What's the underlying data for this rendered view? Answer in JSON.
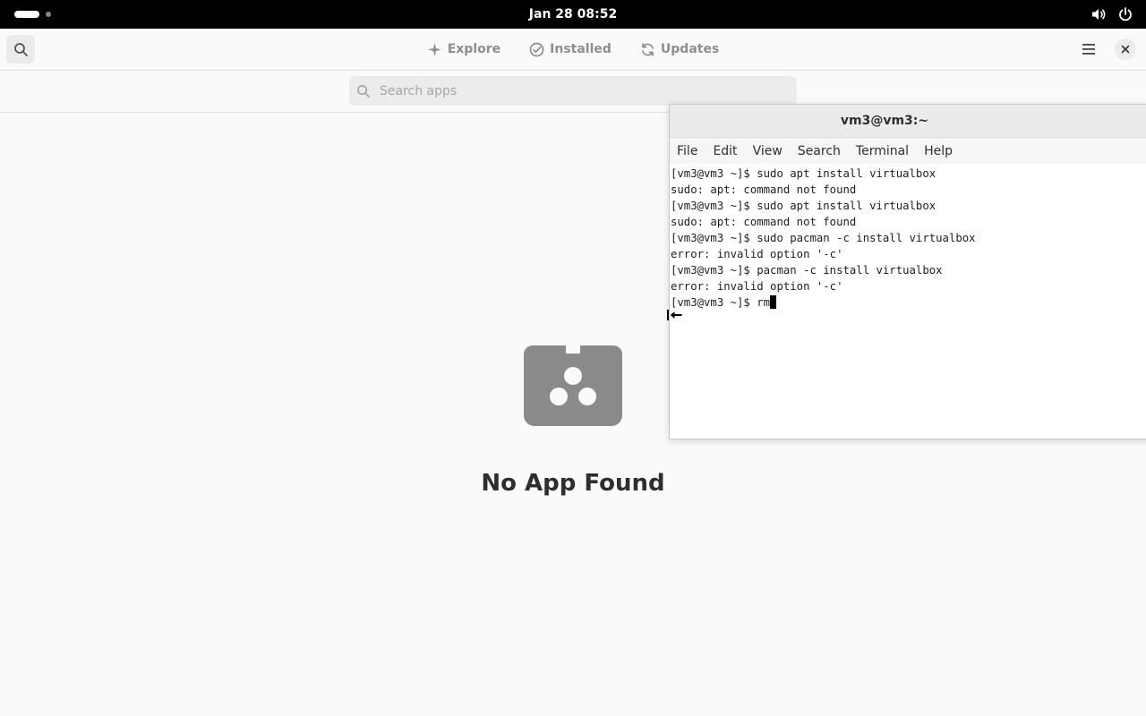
{
  "system_bar": {
    "datetime": "Jan 28  08:52",
    "icons": [
      "volume-icon",
      "power-icon"
    ]
  },
  "app_header": {
    "search_icon": "search-icon",
    "tabs": [
      {
        "label": "Explore",
        "icon": "sparkle-icon"
      },
      {
        "label": "Installed",
        "icon": "check-circle-icon"
      },
      {
        "label": "Updates",
        "icon": "refresh-icon"
      }
    ],
    "menu_icon": "hamburger-icon",
    "close_icon": "close-icon"
  },
  "search": {
    "placeholder": "Search apps",
    "value": ""
  },
  "empty_state": {
    "icon": "shopping-bag-icon",
    "title": "No App Found"
  },
  "terminal": {
    "title": "vm3@vm3:~",
    "menu": [
      "File",
      "Edit",
      "View",
      "Search",
      "Terminal",
      "Help"
    ],
    "lines": [
      "[vm3@vm3 ~]$ sudo apt install virtualbox",
      "sudo: apt: command not found",
      "[vm3@vm3 ~]$ sudo apt install virtualbox",
      "sudo: apt: command not found",
      "[vm3@vm3 ~]$ sudo pacman -c install virtualbox",
      "error: invalid option '-c'",
      "[vm3@vm3 ~]$ pacman -c install virtualbox",
      "error: invalid option '-c'"
    ],
    "prompt": "[vm3@vm3 ~]$ ",
    "current_input": "rm"
  },
  "colors": {
    "topbar": "#000000",
    "app_bg": "#fafafa",
    "muted_text": "#8e8e8e",
    "empty_icon": "#8a8a8a"
  }
}
